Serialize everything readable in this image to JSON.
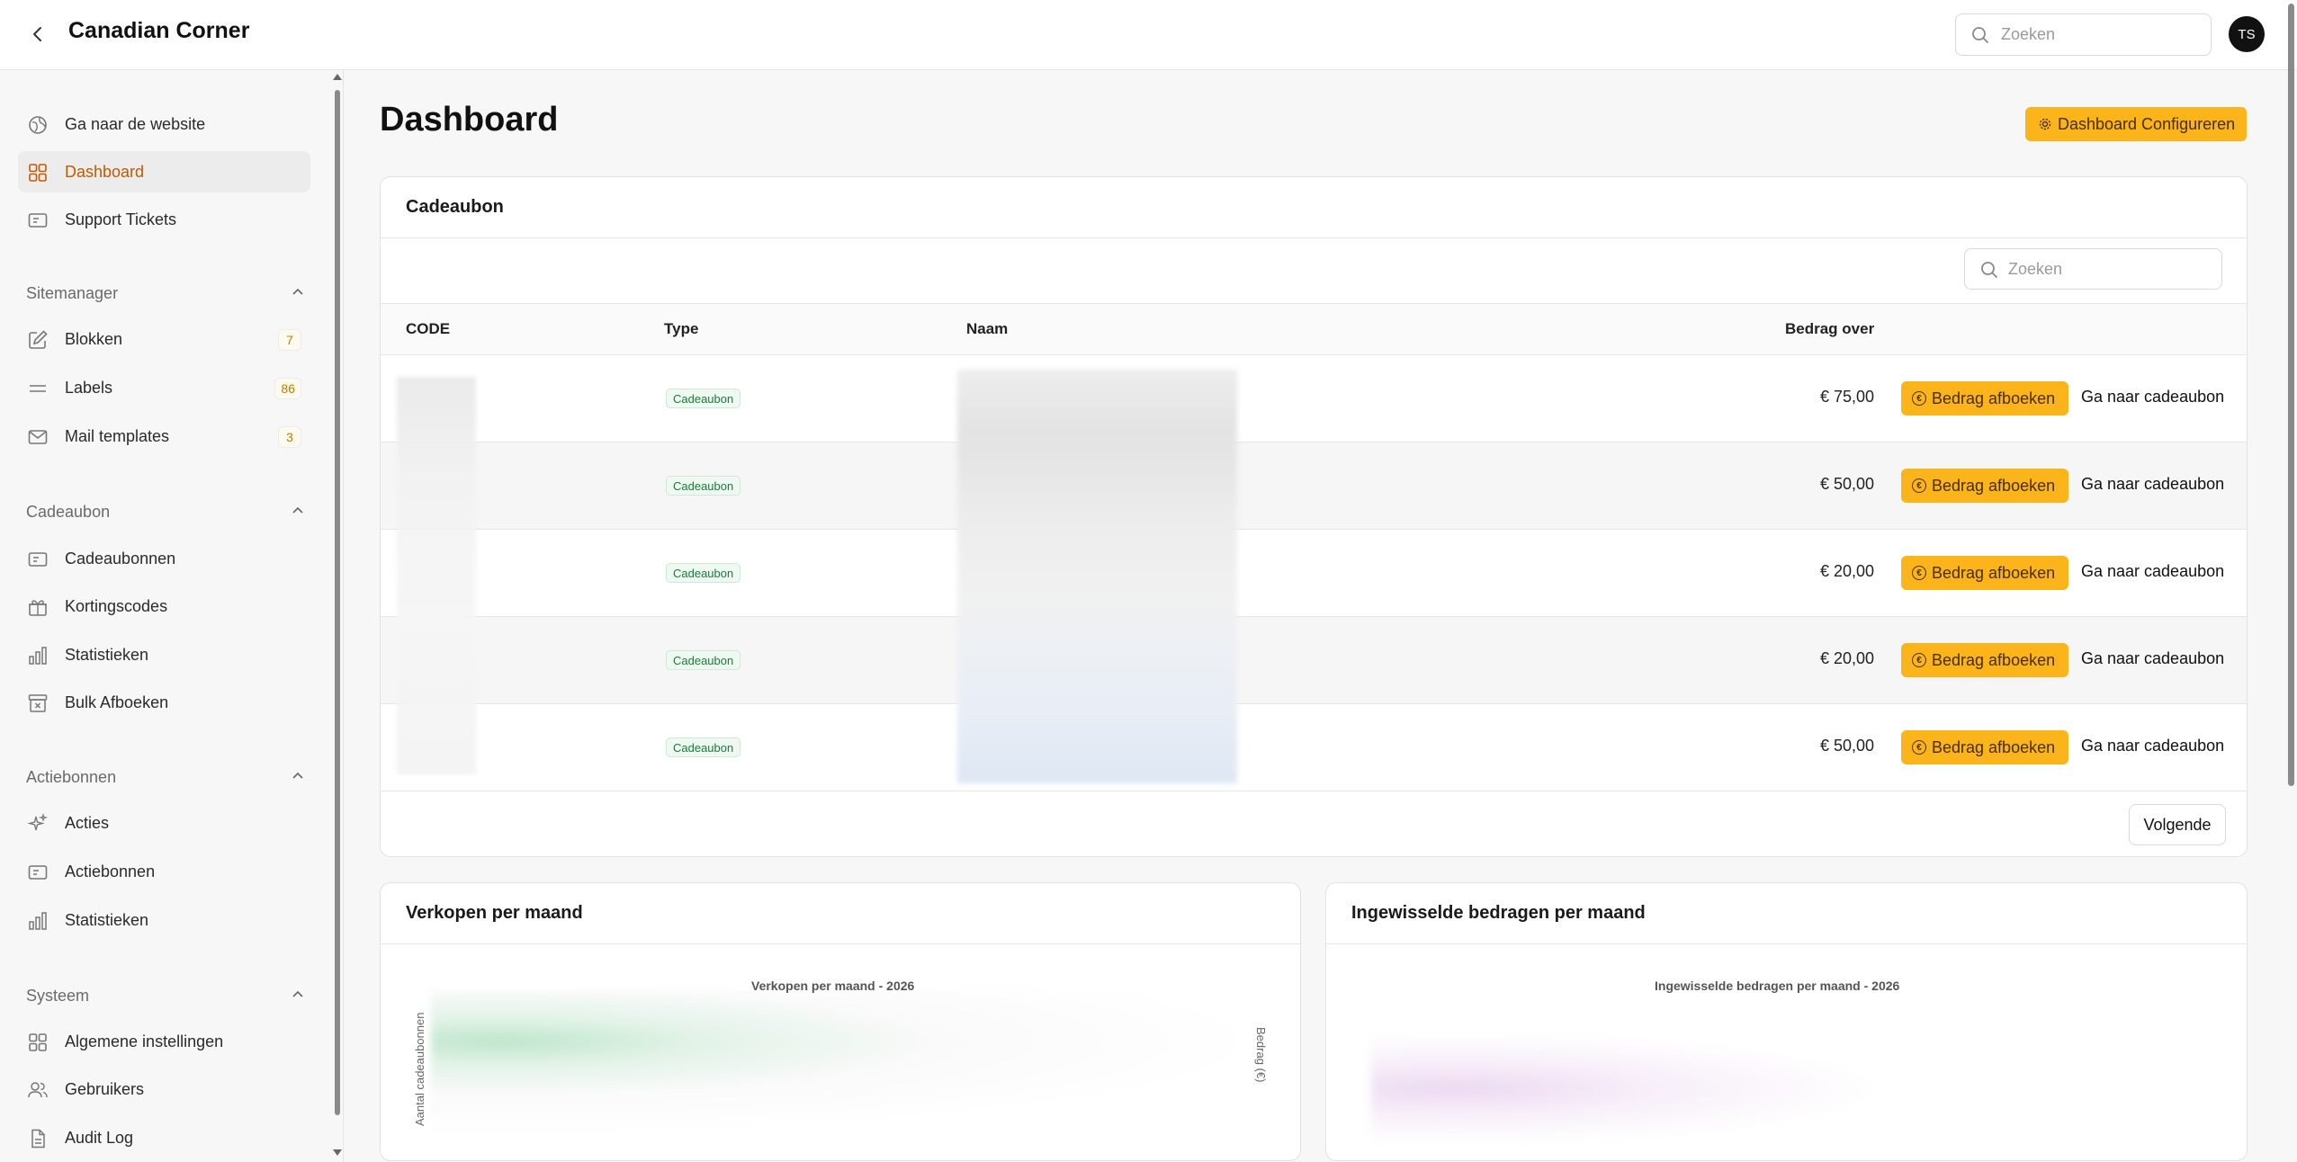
{
  "app": {
    "title": "Canadian Corner",
    "avatar_initials": "TS"
  },
  "search": {
    "placeholder": "Zoeken"
  },
  "sidebar": {
    "top_items": [
      {
        "label": "Ga naar de website",
        "icon": "globe-icon"
      },
      {
        "label": "Dashboard",
        "icon": "grid-icon",
        "active": true
      },
      {
        "label": "Support Tickets",
        "icon": "ticket-icon"
      }
    ],
    "sections": [
      {
        "title": "Sitemanager",
        "items": [
          {
            "label": "Blokken",
            "icon": "edit-icon",
            "badge": "7"
          },
          {
            "label": "Labels",
            "icon": "lines-icon",
            "badge": "86"
          },
          {
            "label": "Mail templates",
            "icon": "mail-icon",
            "badge": "3"
          }
        ]
      },
      {
        "title": "Cadeaubon",
        "items": [
          {
            "label": "Cadeaubonnen",
            "icon": "ticket-icon"
          },
          {
            "label": "Kortingscodes",
            "icon": "gift-icon"
          },
          {
            "label": "Statistieken",
            "icon": "bar-chart-icon"
          },
          {
            "label": "Bulk Afboeken",
            "icon": "archive-x-icon"
          }
        ]
      },
      {
        "title": "Actiebonnen",
        "items": [
          {
            "label": "Acties",
            "icon": "sparkles-icon"
          },
          {
            "label": "Actiebonnen",
            "icon": "ticket-icon"
          },
          {
            "label": "Statistieken",
            "icon": "bar-chart-icon"
          }
        ]
      },
      {
        "title": "Systeem",
        "items": [
          {
            "label": "Algemene instellingen",
            "icon": "grid-icon"
          },
          {
            "label": "Gebruikers",
            "icon": "users-icon"
          },
          {
            "label": "Audit Log",
            "icon": "file-icon"
          }
        ]
      }
    ]
  },
  "main": {
    "title": "Dashboard",
    "config_button": "Dashboard Configureren",
    "giftcard_card": {
      "title": "Cadeaubon",
      "search_placeholder": "Zoeken",
      "columns": [
        "CODE",
        "Type",
        "Naam",
        "Bedrag over"
      ],
      "rows": [
        {
          "type": "Cadeaubon",
          "amount": "€ 75,00"
        },
        {
          "type": "Cadeaubon",
          "amount": "€ 50,00"
        },
        {
          "type": "Cadeaubon",
          "amount": "€ 20,00"
        },
        {
          "type": "Cadeaubon",
          "amount": "€ 20,00"
        },
        {
          "type": "Cadeaubon",
          "amount": "€ 50,00"
        }
      ],
      "row_action": "Bedrag afboeken",
      "row_link": "Ga naar cadeaubon",
      "next_button": "Volgende"
    },
    "sales_card": {
      "title": "Verkopen per maand",
      "chart_title": "Verkopen per maand - 2026",
      "y_left_label": "Aantal cadeaubonnen",
      "y_right_label": "Bedrag (€)"
    },
    "redeemed_card": {
      "title": "Ingewisselde bedragen per maand",
      "chart_title": "Ingewisselde bedragen per maand - 2026"
    }
  },
  "colors": {
    "accent": "#fbb419",
    "active_text": "#c25a00",
    "badge_green": "#1d7a3b"
  }
}
